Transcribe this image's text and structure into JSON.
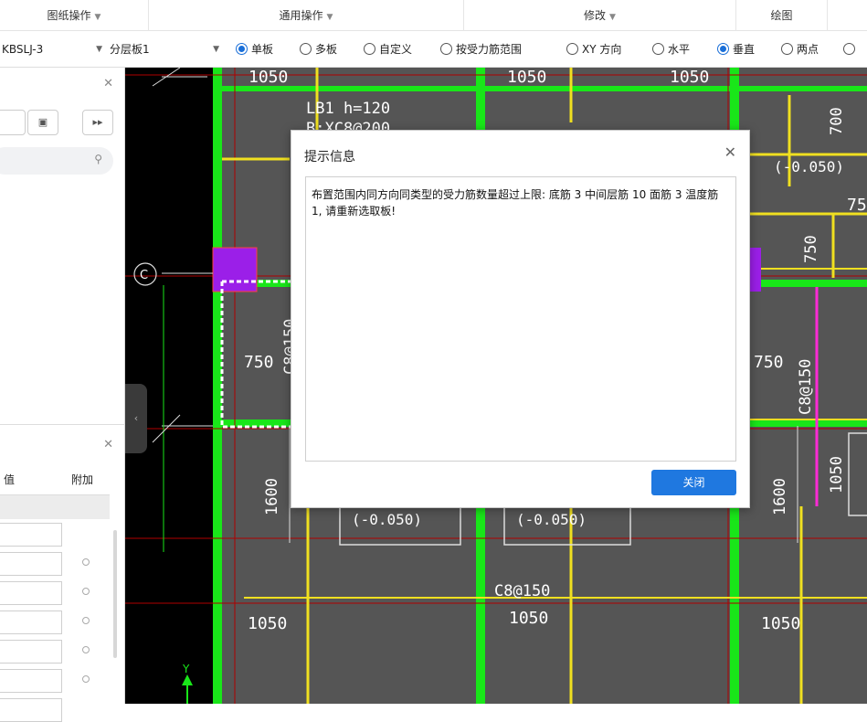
{
  "menu": {
    "groups": [
      {
        "label": "图纸操作"
      },
      {
        "label": "通用操作"
      },
      {
        "label": "修改"
      },
      {
        "label": "绘图"
      }
    ]
  },
  "options": {
    "component_select": "KBSLJ-3",
    "layer_select": "分层板1",
    "radios": [
      {
        "label": "单板",
        "checked": true
      },
      {
        "label": "多板",
        "checked": false
      },
      {
        "label": "自定义",
        "checked": false
      },
      {
        "label": "按受力筋范围",
        "checked": false
      },
      {
        "label": "XY 方向",
        "checked": false
      },
      {
        "label": "水平",
        "checked": false
      },
      {
        "label": "垂直",
        "checked": true
      },
      {
        "label": "两点",
        "checked": false
      }
    ]
  },
  "left_panel": {
    "prop_header_value": "值",
    "prop_header_extra": "附加"
  },
  "cad": {
    "labels": {
      "top_1": "1050",
      "top_2": "1050",
      "top_3": "1050",
      "slab_name": "LB1 h=120",
      "slab_sub": "B:XC8@200",
      "elev_right": "(-0.050)",
      "dim_700": "700",
      "dim_750_tr": "750",
      "dim_750_v": "750",
      "axis_c": "C",
      "dim_750_left": "750",
      "dim_c8_left": "C8@150",
      "dim_750_right": "750",
      "dim_c8_right": "C8@150",
      "dim_1600_left": "1600",
      "dim_1600_right": "1600",
      "dim_1050_v": "1050",
      "elev_mid_left": "(-0.050)",
      "elev_mid_right": "(-0.050)",
      "c8_bottom": "C8@150",
      "bottom_1050_a": "1050",
      "bottom_1050_b": "1050",
      "bottom_1050_c": "1050",
      "y_axis": "Y"
    }
  },
  "dialog": {
    "title": "提示信息",
    "message": "布置范围内同方向同类型的受力筋数量超过上限: 底筋 3 中间层筋 10 面筋 3 温度筋 1, 请重新选取板!",
    "close_button": "关闭"
  },
  "colors": {
    "accent": "#1f78e0",
    "cad_background": "#000000",
    "slab_fill": "#555555",
    "beam_green": "#19e619",
    "rebar_yellow": "#f0e020",
    "grid_red": "#c80000",
    "column_purple": "#9b1fe8"
  }
}
